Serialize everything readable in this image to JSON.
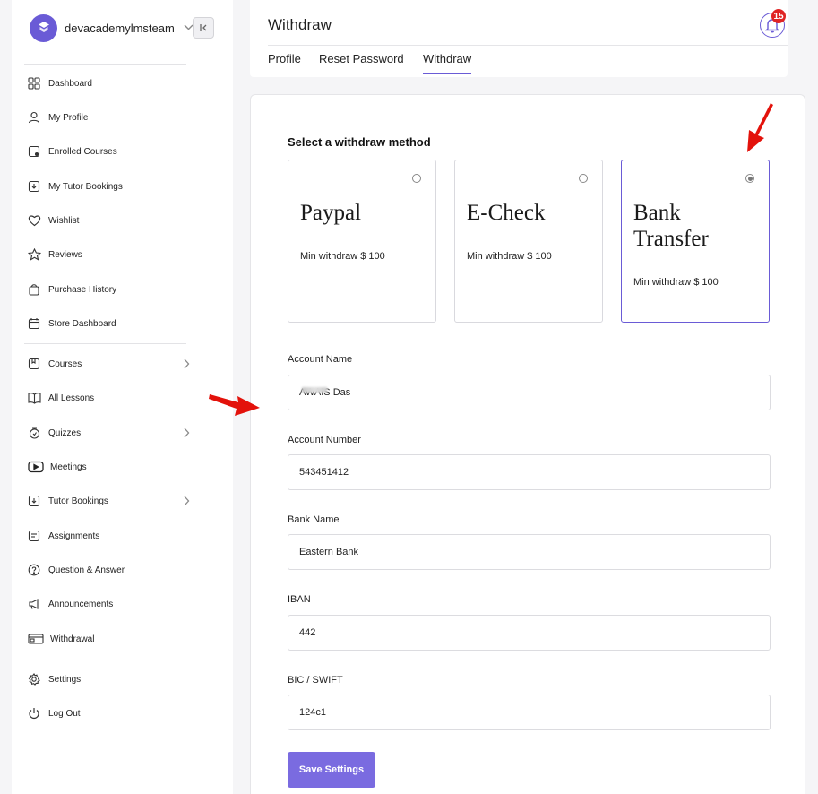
{
  "brand": {
    "name": "devacademylmsteam"
  },
  "sidebar": {
    "group1": [
      {
        "label": "Dashboard",
        "icon": "dashboard-icon"
      },
      {
        "label": "My Profile",
        "icon": "user-icon"
      },
      {
        "label": "Enrolled Courses",
        "icon": "course-icon"
      },
      {
        "label": "My Tutor Bookings",
        "icon": "booking-icon"
      },
      {
        "label": "Wishlist",
        "icon": "heart-icon"
      },
      {
        "label": "Reviews",
        "icon": "star-icon"
      },
      {
        "label": "Purchase History",
        "icon": "cart-icon"
      },
      {
        "label": "Store Dashboard",
        "icon": "store-icon"
      }
    ],
    "group2": [
      {
        "label": "Courses",
        "icon": "courses-icon"
      },
      {
        "label": "All Lessons",
        "icon": "book-icon"
      },
      {
        "label": "Quizzes",
        "icon": "quiz-icon"
      },
      {
        "label": "Meetings",
        "icon": "video-icon"
      },
      {
        "label": "Tutor Bookings",
        "icon": "booking-icon"
      },
      {
        "label": "Assignments",
        "icon": "assignment-icon"
      },
      {
        "label": "Question & Answer",
        "icon": "question-icon"
      },
      {
        "label": "Announcements",
        "icon": "megaphone-icon"
      },
      {
        "label": "Withdrawal",
        "icon": "wallet-icon"
      }
    ],
    "group3": [
      {
        "label": "Settings",
        "icon": "gear-icon"
      },
      {
        "label": "Log Out",
        "icon": "power-icon"
      }
    ]
  },
  "header": {
    "title": "Withdraw",
    "notification_count": "15",
    "tabs": [
      {
        "label": "Profile"
      },
      {
        "label": "Reset Password"
      },
      {
        "label": "Withdraw",
        "active": true
      }
    ]
  },
  "withdraw": {
    "section_title": "Select a withdraw method",
    "methods": [
      {
        "name": "Paypal",
        "min": "Min withdraw $ 100",
        "selected": false
      },
      {
        "name": "E-Check",
        "min": "Min withdraw $ 100",
        "selected": false
      },
      {
        "name": "Bank Transfer",
        "min": "Min withdraw $ 100",
        "selected": true
      }
    ],
    "fields": [
      {
        "label": "Account Name",
        "value": "AWAIS Das"
      },
      {
        "label": "Account Number",
        "value": "543451412"
      },
      {
        "label": "Bank Name",
        "value": "Eastern Bank"
      },
      {
        "label": "IBAN",
        "value": "442"
      },
      {
        "label": "BIC / SWIFT",
        "value": "124c1"
      }
    ],
    "save_label": "Save Settings"
  },
  "colors": {
    "accent": "#6a5bd6",
    "button": "#7a6be0",
    "badge": "#e02424",
    "arrow": "#e3120b"
  }
}
